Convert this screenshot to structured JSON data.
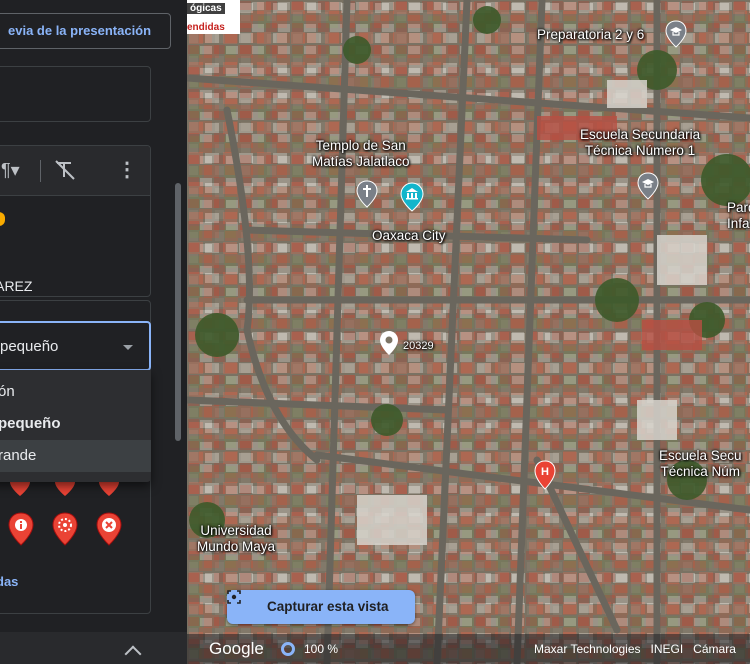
{
  "panel": {
    "preview_button": "evia de la presentación",
    "editor_text": "UAREZ",
    "select": {
      "value": "pequeño",
      "options": [
        "ón",
        "pequeño",
        "rande"
      ]
    },
    "more_link": "das"
  },
  "map": {
    "top_left_1": "ógicas",
    "top_left_2": "endidas",
    "labels": {
      "preparatoria": "Preparatoria 2 y 6",
      "templo": "Templo de San\nMatías Jalatlaco",
      "escuela1": "Escuela Secundaria\nTécnica Número 1",
      "oaxaca": "Oaxaca City",
      "park": "Parq\nInfa",
      "pin_number": "20329",
      "escuela2": "Escuela Secu\nTécnica Núm",
      "universidad": "Universidad\nMundo Maya"
    },
    "capture_button": "Capturar esta vista",
    "footer": {
      "google": "Google",
      "zoom": "100 %",
      "credits": "Maxar Technologies   INEGI   Cámara"
    }
  },
  "colors": {
    "accent": "#8ab4f8",
    "panel_bg": "#202124",
    "pin_red": "#ea4335"
  }
}
